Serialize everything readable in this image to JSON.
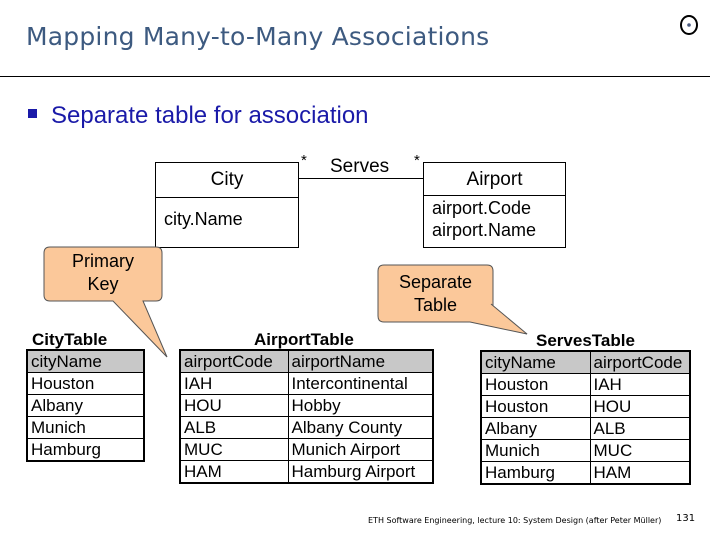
{
  "slide": {
    "title": "Mapping Many-to-Many Associations",
    "logo_icon": "eth-circle-logo-icon",
    "bullet": "Separate table for association"
  },
  "uml": {
    "city": {
      "name": "City",
      "attributes": [
        "city.Name"
      ]
    },
    "airport": {
      "name": "Airport",
      "attributes": [
        "airport.Code",
        "airport.Name"
      ]
    },
    "association": {
      "label": "Serves",
      "multiplicity_left": "*",
      "multiplicity_right": "*"
    }
  },
  "callouts": {
    "primary_key": [
      "Primary",
      "Key"
    ],
    "separate_table": [
      "Separate",
      "Table"
    ]
  },
  "tables": {
    "city": {
      "title": "CityTable",
      "headers": [
        "cityName"
      ],
      "rows": [
        [
          "Houston"
        ],
        [
          "Albany"
        ],
        [
          "Munich"
        ],
        [
          "Hamburg"
        ]
      ]
    },
    "airport": {
      "title": "AirportTable",
      "headers": [
        "airportCode",
        "airportName"
      ],
      "rows": [
        [
          "IAH",
          "Intercontinental"
        ],
        [
          "HOU",
          "Hobby"
        ],
        [
          "ALB",
          "Albany County"
        ],
        [
          "MUC",
          "Munich Airport"
        ],
        [
          "HAM",
          "Hamburg Airport"
        ]
      ]
    },
    "serves": {
      "title": "ServesTable",
      "headers": [
        "cityName",
        "airportCode"
      ],
      "rows": [
        [
          "Houston",
          "IAH"
        ],
        [
          "Houston",
          "HOU"
        ],
        [
          "Albany",
          "ALB"
        ],
        [
          "Munich",
          "MUC"
        ],
        [
          "Hamburg",
          "HAM"
        ]
      ]
    }
  },
  "footer": {
    "text": "ETH Software Engineering, lecture 10: System Design (after Peter Müller)",
    "page_number": "131"
  },
  "colors": {
    "title": "#3d5a80",
    "bullet": "#1a1aa8",
    "callout_fill": "#fbc89a",
    "table_header": "#c8c8c8"
  }
}
